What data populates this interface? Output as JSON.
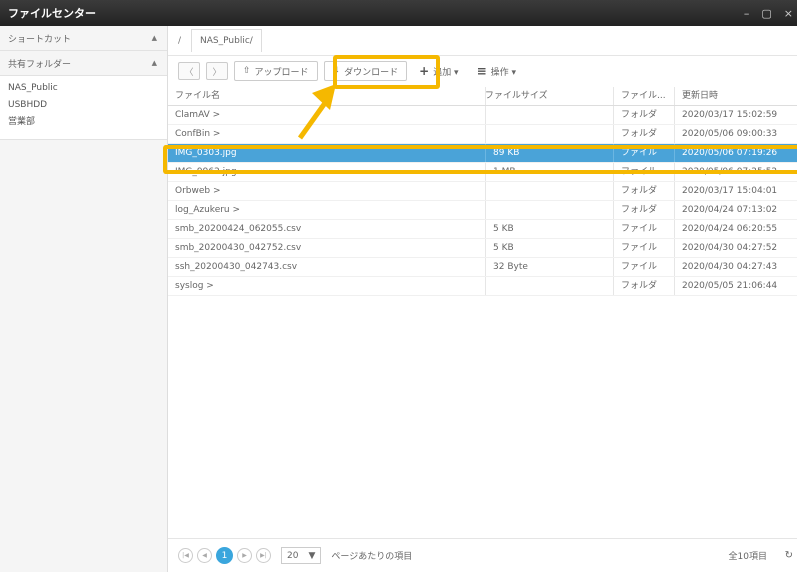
{
  "app": {
    "title": "ファイルセンター",
    "controls": [
      "–",
      "▢",
      "×"
    ]
  },
  "sidebar": {
    "shortcut_label": "ショートカット",
    "shared_label": "共有フォルダー",
    "caret": "▲",
    "items": [
      {
        "label": "NAS_Public"
      },
      {
        "label": "USBHDD"
      },
      {
        "label": "営業部"
      }
    ]
  },
  "breadcrumb": {
    "root": "/",
    "item": "NAS_Public/"
  },
  "toolbar": {
    "back": "〈",
    "forward": "〉",
    "upload": {
      "icon": "⇧",
      "label": "アップロード"
    },
    "download": {
      "icon": "⇩",
      "label": "ダウンロード"
    },
    "add": {
      "icon": "+",
      "label": "追加 ▾"
    },
    "operate": {
      "icon": "≡",
      "label": "操作 ▾"
    }
  },
  "table": {
    "headers": {
      "name": "ファイル名",
      "size": "ファイルサイズ",
      "type": "ファイル...",
      "date": "更新日時",
      "filter_icon": "▼"
    },
    "rows": [
      {
        "name": "ClamAV >",
        "size": "",
        "type": "フォルダ",
        "date": "2020/03/17 15:02:59",
        "selected": false
      },
      {
        "name": "ConfBin >",
        "size": "",
        "type": "フォルダ",
        "date": "2020/05/06 09:00:33",
        "selected": false
      },
      {
        "name": "IMG_0303.jpg",
        "size": "89 KB",
        "type": "ファイル",
        "date": "2020/05/06 07:19:26",
        "selected": true
      },
      {
        "name": "IMG_9962.jpg",
        "size": "1 MB",
        "type": "ファイル",
        "date": "2020/05/06 07:25:52",
        "selected": false
      },
      {
        "name": "Orbweb >",
        "size": "",
        "type": "フォルダ",
        "date": "2020/03/17 15:04:01",
        "selected": false
      },
      {
        "name": "log_Azukeru >",
        "size": "",
        "type": "フォルダ",
        "date": "2020/04/24 07:13:02",
        "selected": false
      },
      {
        "name": "smb_20200424_062055.csv",
        "size": "5 KB",
        "type": "ファイル",
        "date": "2020/04/24 06:20:55",
        "selected": false
      },
      {
        "name": "smb_20200430_042752.csv",
        "size": "5 KB",
        "type": "ファイル",
        "date": "2020/04/30 04:27:52",
        "selected": false
      },
      {
        "name": "ssh_20200430_042743.csv",
        "size": "32 Byte",
        "type": "ファイル",
        "date": "2020/04/30 04:27:43",
        "selected": false
      },
      {
        "name": "syslog >",
        "size": "",
        "type": "フォルダ",
        "date": "2020/05/05 21:06:44",
        "selected": false
      }
    ]
  },
  "pager": {
    "first": "|◀",
    "prev": "◀",
    "page": "1",
    "next": "▶",
    "last": "▶|",
    "page_size": "20",
    "page_size_caret": "▼",
    "per_page_label": "ページあたりの項目",
    "total": "全10項目",
    "refresh_icon": "↻"
  },
  "annotation": {
    "color": "#f5b800"
  }
}
